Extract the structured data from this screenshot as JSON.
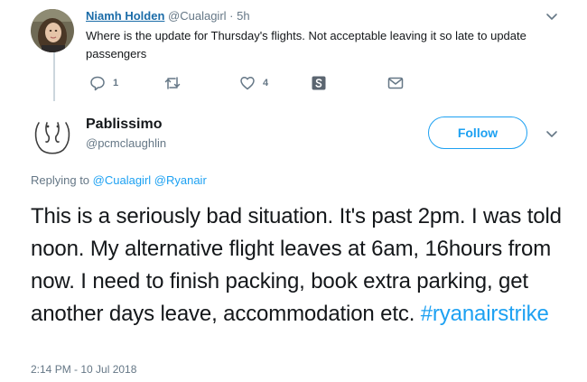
{
  "parent_tweet": {
    "author_name": "Niamh Holden",
    "author_handle": "@Cualagirl",
    "separator": "·",
    "time": "5h",
    "text": "Where is the update for Thursday's flights. Not acceptable leaving it so late to update passengers",
    "actions": {
      "reply_icon": "reply-icon",
      "reply_count": "1",
      "retweet_icon": "retweet-icon",
      "retweet_count": "",
      "like_icon": "heart-icon",
      "like_count": "4",
      "extension_icon": "s-badge-icon",
      "dm_icon": "envelope-icon"
    }
  },
  "main_tweet": {
    "author_name": "Pablissimo",
    "author_handle": "@pcmclaughlin",
    "follow_label": "Follow",
    "replying_prefix": "Replying to ",
    "replying_to": [
      "@Cualagirl",
      "@Ryanair"
    ],
    "text": "This is a seriously bad situation. It's past 2pm. I was told noon. My alternative flight leaves at 6am, 16hours from now. I need to finish packing, book extra parking, get another days leave, accommodation etc. ",
    "hashtag": "#ryanairstrike",
    "timestamp": "2:14 PM - 10 Jul 2018"
  },
  "colors": {
    "link_blue": "#1da1f2",
    "name_link": "#1b6ca8",
    "secondary_text": "#657786",
    "primary_text": "#14171a",
    "thread_line": "#ccd6dd"
  }
}
